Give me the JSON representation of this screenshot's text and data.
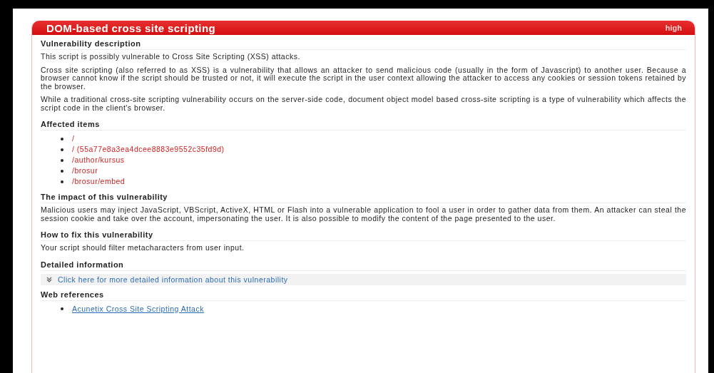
{
  "alert": {
    "title": "DOM-based cross site scripting",
    "severity": "high"
  },
  "sections": [
    {
      "kind": "paragraphs",
      "heading": "Vulnerability description",
      "paragraphs": [
        "This script is possibly vulnerable to Cross Site Scripting (XSS) attacks.",
        "Cross site scripting (also referred to as XSS) is a vulnerability that allows an attacker to send malicious code (usually in the form of Javascript) to another user. Because a browser cannot know if the script should be trusted or not, it will execute the script in the user context allowing the attacker to access any cookies or session tokens retained by the browser.",
        "While a traditional cross-site scripting vulnerability occurs on the server-side code, document object model based cross-site scripting is a type of vulnerability which affects the script code in the client's browser."
      ]
    },
    {
      "kind": "items",
      "heading": "Affected items",
      "items": [
        "/",
        "/ (55a77e8a3ea4dcee8883e9552c35fd9d)",
        "/author/kursus",
        "/brosur",
        "/brosur/embed"
      ]
    },
    {
      "kind": "paragraphs",
      "heading": "The impact of this vulnerability",
      "paragraphs": [
        "Malicious users may inject JavaScript, VBScript, ActiveX, HTML or Flash into a vulnerable application to fool a user in order to gather data from them. An attacker can steal the session cookie and take over the account, impersonating the user. It is also possible to modify the content of the page presented to the user."
      ]
    },
    {
      "kind": "paragraphs",
      "heading": "How to fix this vulnerability",
      "paragraphs": [
        "Your script should filter metacharacters from user input."
      ]
    },
    {
      "kind": "expander",
      "heading": "Detailed information",
      "link": "Click here for more detailed information about this vulnerability"
    },
    {
      "kind": "links",
      "heading": "Web references",
      "items": [
        "Acunetix Cross Site Scripting Attack"
      ]
    }
  ]
}
